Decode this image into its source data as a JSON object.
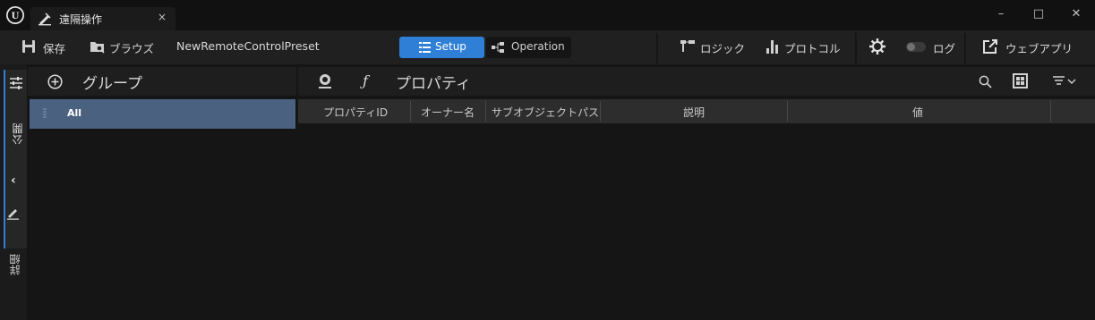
{
  "tab": {
    "title": "遠隔操作",
    "close": "×"
  },
  "window": {
    "minimize": "–",
    "maximize": "□",
    "close": "✕"
  },
  "toolbar": {
    "save": "保存",
    "browse": "ブラウズ",
    "preset_name": "NewRemoteControlPreset",
    "setup": "Setup",
    "operation": "Operation",
    "logic": "ロジック",
    "protocol": "プロトコル",
    "log": "ログ",
    "web_app": "ウェブアプリ"
  },
  "rail": {
    "expose": "公開",
    "details": "詳細"
  },
  "group_panel": {
    "title": "グループ",
    "items": [
      {
        "label": "All",
        "selected": true
      }
    ]
  },
  "property_panel": {
    "title": "プロパティ",
    "columns": [
      "プロパティID",
      "オーナー名",
      "サブオブジェクトパス",
      "説明",
      "値"
    ]
  },
  "colors": {
    "accent": "#2f7fd6",
    "selected_row": "#4a6180",
    "background": "#151515"
  }
}
